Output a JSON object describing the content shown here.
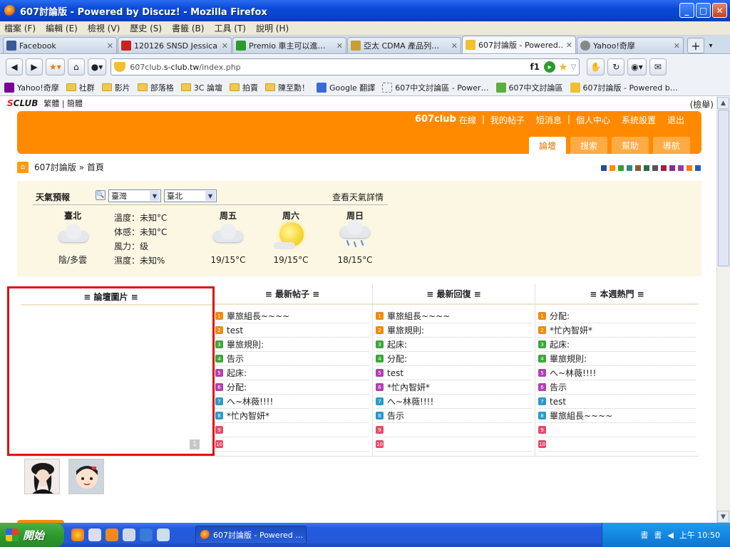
{
  "window": {
    "title": "607討論版 - Powered by Discuz! - Mozilla Firefox",
    "buttons": {
      "minimize": "_",
      "maximize": "□",
      "close": "✕"
    }
  },
  "menubar": [
    "檔案 (F)",
    "編輯 (E)",
    "檢視 (V)",
    "歷史 (S)",
    "書籤 (B)",
    "工具 (T)",
    "說明 (H)"
  ],
  "tabs": [
    {
      "label": "Facebook",
      "icon_color": "#3b5998",
      "active": false
    },
    {
      "label": "120126 SNSD Jessica …",
      "icon_color": "#cc2020",
      "active": false
    },
    {
      "label": "Premio 車主可以進…",
      "icon_color": "#2a9c2a",
      "active": false
    },
    {
      "label": "亞太 CDMA 產品列…",
      "icon_color": "#c8a030",
      "active": false
    },
    {
      "label": "607討論版 - Powered…",
      "icon_color": "#f0c030",
      "active": true
    },
    {
      "label": "Yahoo!奇摩",
      "icon_color": "#888888",
      "active": false
    }
  ],
  "navbar": {
    "url_prefix": "607club.",
    "url_domain": "s-club.tw",
    "url_path": "/index.php",
    "f1": "f1"
  },
  "bookmarks": [
    "Yahoo!奇摩",
    "社群",
    "影片",
    "部落格",
    "3C 論壇",
    "拍賣",
    "陳至勳！",
    "Google 翻譯",
    "607中文討論區 - Power…",
    "607中文討論區",
    "607討論版 - Powered b…"
  ],
  "page": {
    "logo_a": "S",
    "logo_b": "CLUB",
    "lang_links": "繁體 | 簡體",
    "search_link": "(檢舉)",
    "header_links": {
      "site": "607club",
      "online": "在線",
      "my_posts": "我的帖子",
      "pm": "短消息",
      "profile": "個人中心",
      "settings": "系統設置",
      "logout": "退出"
    },
    "nav_tabs": [
      "論壇",
      "搜索",
      "幫助",
      "導航"
    ],
    "breadcrumb": "607討論版 » 首頁",
    "swatch_colors": [
      "#1f4e9a",
      "#ff8a00",
      "#3a9a3a",
      "#2a8a8a",
      "#8a5a2a",
      "#2a6a4a",
      "#555555",
      "#a02040",
      "#8a2a8a",
      "#9a3aa0",
      "#ff7a10",
      "#2a5aaa"
    ]
  },
  "weather": {
    "title": "天氣預報",
    "country": "臺灣",
    "city_select": "臺北",
    "detail_link": "查看天氣詳情",
    "city": "臺北",
    "now": "陰/多雲",
    "stats": [
      "溫度：未知°C",
      "体感：未知°C",
      "風力：级",
      "濕度：未知%"
    ],
    "days": [
      {
        "name": "周五",
        "temp": "19/15°C",
        "icon": "cloud-icon"
      },
      {
        "name": "周六",
        "temp": "19/15°C",
        "icon": "sun-icon"
      },
      {
        "name": "周日",
        "temp": "18/15°C",
        "icon": "rain-icon"
      }
    ]
  },
  "panels": {
    "pictures": {
      "title": "≡ 論壇圖片 ≡"
    },
    "latest_posts": {
      "title": "≡ 最新帖子 ≡",
      "items": [
        "畢旅組長~~~~",
        "test",
        "畢旅規則:",
        "告示",
        "起床:",
        "分配:",
        "へ~林薇!!!!",
        "*忙內智妍*",
        "",
        ""
      ]
    },
    "latest_replies": {
      "title": "≡ 最新回復 ≡",
      "items": [
        "畢旅組長~~~~",
        "畢旅規則:",
        "起床:",
        "分配:",
        "test",
        "*忙內智妍*",
        "へ~林薇!!!!",
        "告示",
        "",
        ""
      ]
    },
    "hot": {
      "title": "≡ 本週熱門 ≡",
      "items": [
        "分配:",
        "*忙內智妍*",
        "起床:",
        "畢旅規則:",
        "へ~林薇!!!!",
        "告示",
        "test",
        "畢旅組長~~~~",
        "",
        ""
      ]
    },
    "num_colors": [
      "#f08a10",
      "#f08a10",
      "#3aa83a",
      "#3aa83a",
      "#b040b0",
      "#b040b0",
      "#2a9acb",
      "#2a9acb",
      "#e84a6a",
      "#e84a6a"
    ],
    "num_labels": [
      "1",
      "2",
      "3",
      "4",
      "5",
      "6",
      "7",
      "8",
      "9",
      "10"
    ]
  },
  "taskbar": {
    "start": "開始",
    "task": "607討論版 - Powered …",
    "time": "上午 10:50"
  }
}
